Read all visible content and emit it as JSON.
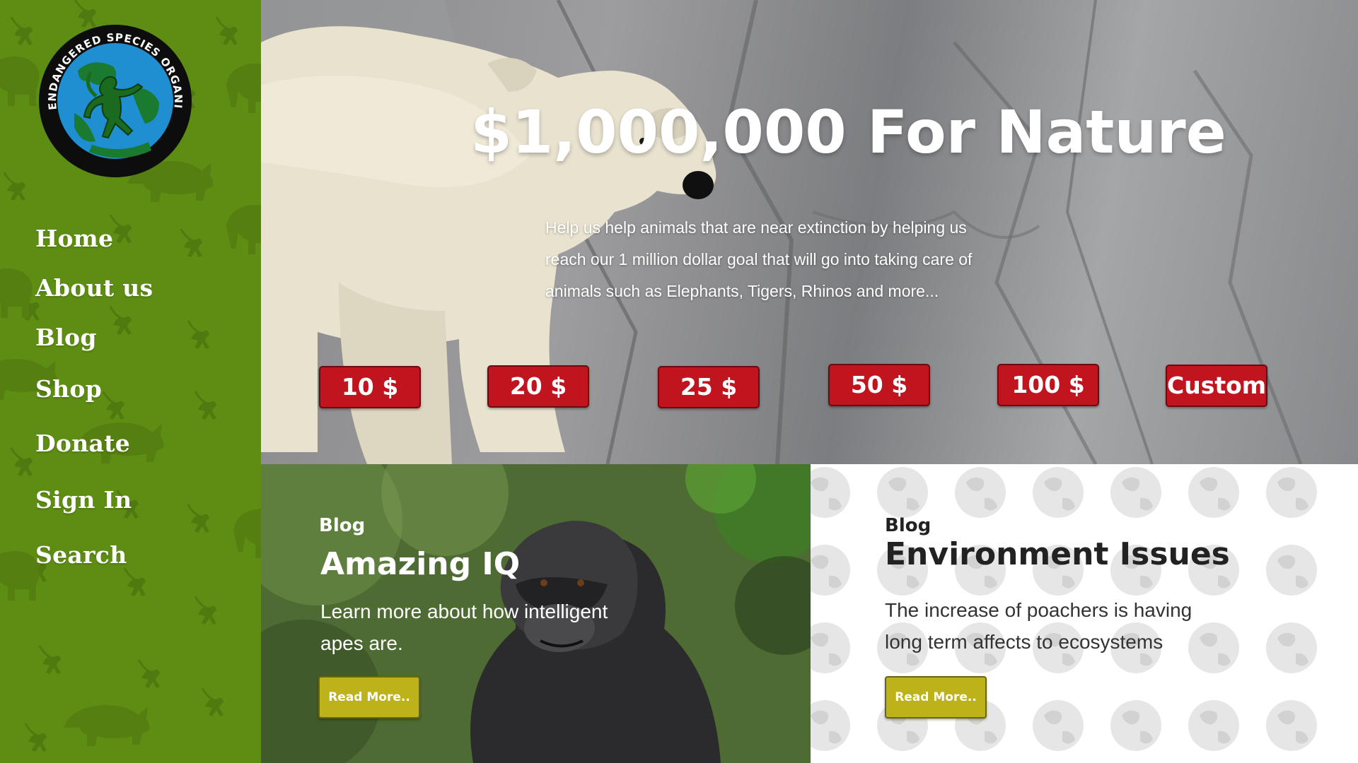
{
  "logo": {
    "text": "ENDANGERED SPECIES ORGANIZATION"
  },
  "nav": {
    "items": [
      {
        "label": "Home"
      },
      {
        "label": "About us"
      },
      {
        "label": "Blog"
      },
      {
        "label": "Shop"
      },
      {
        "label": "Donate"
      },
      {
        "label": "Sign In"
      },
      {
        "label": "Search"
      }
    ]
  },
  "hero": {
    "title": "$1,000,000 For Nature",
    "text": "Help us help animals that are near extinction by helping us reach our 1 million dollar goal that will go into taking care of animals such as Elephants, Tigers, Rhinos and more...",
    "amounts": [
      {
        "label": "10 $"
      },
      {
        "label": "20 $"
      },
      {
        "label": "25 $"
      },
      {
        "label": "50 $"
      },
      {
        "label": "100 $"
      },
      {
        "label": "Custom"
      }
    ]
  },
  "cards": {
    "left": {
      "tag": "Blog",
      "title": "Amazing IQ",
      "text": "Learn more about how intelligent apes are.",
      "button": "Read More.."
    },
    "right": {
      "tag": "Blog",
      "title": "Environment Issues",
      "text": "The increase of poachers is having long term affects to ecosystems",
      "button": "Read More.."
    }
  },
  "colors": {
    "sidebar_green": "#5e8d14",
    "donate_red": "#c0141e",
    "read_more_yellow": "#bdb21a"
  },
  "icons": [
    "monkey-pattern",
    "rhino-pattern",
    "globe-monkey-logo",
    "polar-bear-photo",
    "gorilla-photo",
    "globe-pattern"
  ]
}
